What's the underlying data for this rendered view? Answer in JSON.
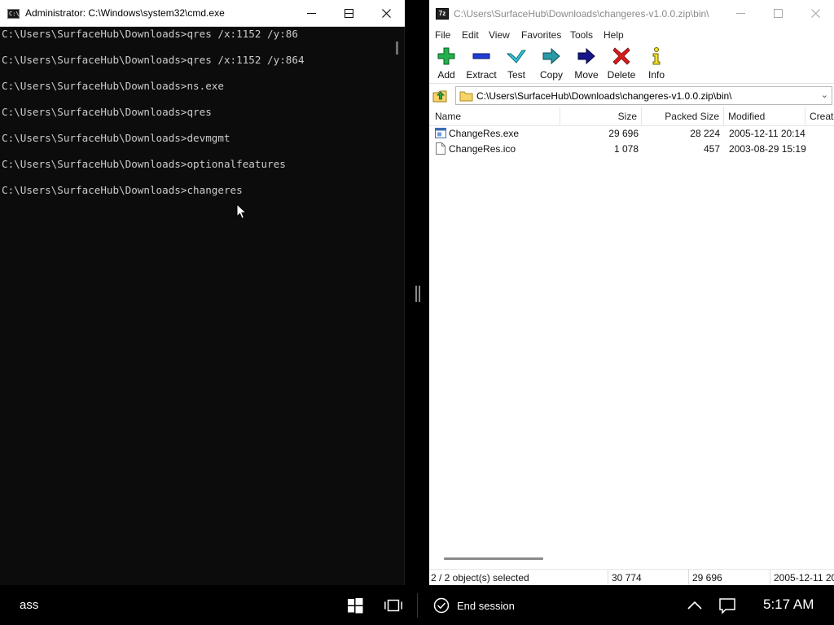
{
  "cmd": {
    "title": "Administrator: C:\\Windows\\system32\\cmd.exe",
    "icon_label": "C:\\",
    "lines": [
      "C:\\Users\\SurfaceHub\\Downloads>qres /x:1152 /y:86",
      "C:\\Users\\SurfaceHub\\Downloads>qres /x:1152 /y:864",
      "C:\\Users\\SurfaceHub\\Downloads>ns.exe",
      "C:\\Users\\SurfaceHub\\Downloads>qres",
      "C:\\Users\\SurfaceHub\\Downloads>devmgmt",
      "C:\\Users\\SurfaceHub\\Downloads>optionalfeatures",
      "C:\\Users\\SurfaceHub\\Downloads>changeres"
    ]
  },
  "zip": {
    "title": "C:\\Users\\SurfaceHub\\Downloads\\changeres-v1.0.0.zip\\bin\\",
    "icon_label": "7z",
    "menu": [
      "File",
      "Edit",
      "View",
      "Favorites",
      "Tools",
      "Help"
    ],
    "toolbar": [
      "Add",
      "Extract",
      "Test",
      "Copy",
      "Move",
      "Delete",
      "Info"
    ],
    "path": "C:\\Users\\SurfaceHub\\Downloads\\changeres-v1.0.0.zip\\bin\\",
    "columns": [
      "Name",
      "Size",
      "Packed Size",
      "Modified",
      "Creat"
    ],
    "files": [
      {
        "name": "ChangeRes.exe",
        "size": "29 696",
        "packed": "28 224",
        "modified": "2005-12-11 20:14",
        "icon": "exe-file-icon"
      },
      {
        "name": "ChangeRes.ico",
        "size": "1 078",
        "packed": "457",
        "modified": "2003-08-29 15:19",
        "icon": "ico-file-icon"
      }
    ],
    "status": {
      "selected": "2 / 2 object(s) selected",
      "size": "30 774",
      "packed": "29 696",
      "modified": "2005-12-11 20"
    }
  },
  "taskbar": {
    "app_label": "ass",
    "end_session": "End session",
    "clock": "5:17 AM"
  }
}
